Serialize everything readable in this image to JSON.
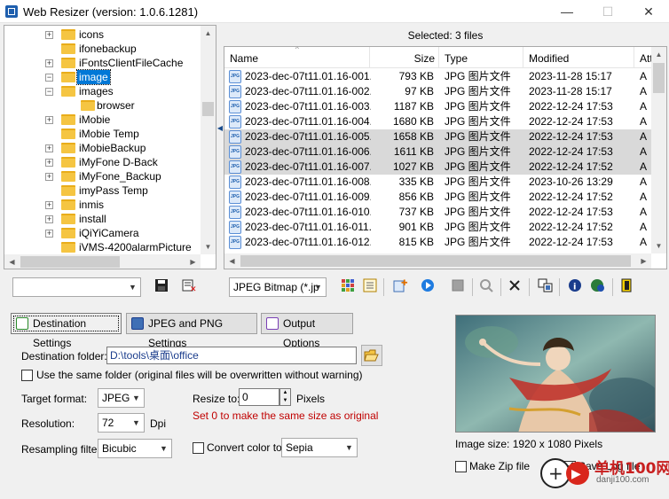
{
  "window": {
    "title": "Web Resizer (version: 1.0.6.1281)"
  },
  "tree": {
    "items": [
      {
        "label": "icons",
        "indent": 1,
        "expander": "+"
      },
      {
        "label": "ifonebackup",
        "indent": 1,
        "expander": ""
      },
      {
        "label": "iFontsClientFileCache",
        "indent": 1,
        "expander": "+"
      },
      {
        "label": "image",
        "indent": 1,
        "expander": "−",
        "selected": true
      },
      {
        "label": "images",
        "indent": 1,
        "expander": "−"
      },
      {
        "label": "browser",
        "indent": 2,
        "expander": ""
      },
      {
        "label": "iMobie",
        "indent": 1,
        "expander": "+"
      },
      {
        "label": "iMobie Temp",
        "indent": 1,
        "expander": ""
      },
      {
        "label": "iMobieBackup",
        "indent": 1,
        "expander": "+"
      },
      {
        "label": "iMyFone D-Back",
        "indent": 1,
        "expander": "+"
      },
      {
        "label": "iMyFone_Backup",
        "indent": 1,
        "expander": "+"
      },
      {
        "label": "imyPass Temp",
        "indent": 1,
        "expander": ""
      },
      {
        "label": "inmis",
        "indent": 1,
        "expander": "+"
      },
      {
        "label": "install",
        "indent": 1,
        "expander": "+"
      },
      {
        "label": "iQiYiCamera",
        "indent": 1,
        "expander": "+"
      },
      {
        "label": "iVMS-4200alarmPicture",
        "indent": 1,
        "expander": ""
      }
    ]
  },
  "filelist": {
    "selected_text": "Selected: 3 files",
    "columns": [
      "Name",
      "Size",
      "Type",
      "Modified",
      "Att"
    ],
    "rows": [
      {
        "name": "2023-dec-07t11.01.16-001.j...",
        "size": "793 KB",
        "type": "JPG 图片文件",
        "modified": "2023-11-28 15:17",
        "attr": "A",
        "sel": false
      },
      {
        "name": "2023-dec-07t11.01.16-002.j...",
        "size": "97 KB",
        "type": "JPG 图片文件",
        "modified": "2023-11-28 15:17",
        "attr": "A",
        "sel": false
      },
      {
        "name": "2023-dec-07t11.01.16-003.j...",
        "size": "1187 KB",
        "type": "JPG 图片文件",
        "modified": "2022-12-24 17:53",
        "attr": "A",
        "sel": false
      },
      {
        "name": "2023-dec-07t11.01.16-004.j...",
        "size": "1680 KB",
        "type": "JPG 图片文件",
        "modified": "2022-12-24 17:53",
        "attr": "A",
        "sel": false
      },
      {
        "name": "2023-dec-07t11.01.16-005.j...",
        "size": "1658 KB",
        "type": "JPG 图片文件",
        "modified": "2022-12-24 17:53",
        "attr": "A",
        "sel": true
      },
      {
        "name": "2023-dec-07t11.01.16-006.j...",
        "size": "1611 KB",
        "type": "JPG 图片文件",
        "modified": "2022-12-24 17:53",
        "attr": "A",
        "sel": true
      },
      {
        "name": "2023-dec-07t11.01.16-007.j...",
        "size": "1027 KB",
        "type": "JPG 图片文件",
        "modified": "2022-12-24 17:52",
        "attr": "A",
        "sel": true
      },
      {
        "name": "2023-dec-07t11.01.16-008.j...",
        "size": "335 KB",
        "type": "JPG 图片文件",
        "modified": "2023-10-26 13:29",
        "attr": "A",
        "sel": false
      },
      {
        "name": "2023-dec-07t11.01.16-009.j...",
        "size": "856 KB",
        "type": "JPG 图片文件",
        "modified": "2022-12-24 17:52",
        "attr": "A",
        "sel": false
      },
      {
        "name": "2023-dec-07t11.01.16-010.j...",
        "size": "737 KB",
        "type": "JPG 图片文件",
        "modified": "2022-12-24 17:53",
        "attr": "A",
        "sel": false
      },
      {
        "name": "2023-dec-07t11.01.16-011.j...",
        "size": "901 KB",
        "type": "JPG 图片文件",
        "modified": "2022-12-24 17:52",
        "attr": "A",
        "sel": false
      },
      {
        "name": "2023-dec-07t11.01.16-012.j...",
        "size": "815 KB",
        "type": "JPG 图片文件",
        "modified": "2022-12-24 17:53",
        "attr": "A",
        "sel": false
      }
    ]
  },
  "toolbar": {
    "profile_value": "",
    "format_value": "JPEG Bitmap (*.jp"
  },
  "tabs": {
    "destination": "Destination Settings",
    "jpeg_png": "JPEG and PNG Settings",
    "output": "Output Options"
  },
  "settings": {
    "dest_folder_label": "Destination folder:",
    "dest_folder_value": "D:\\tools\\桌面\\office",
    "same_folder_label": "Use the same folder (original files will be overwritten without warning)",
    "target_format_label": "Target format:",
    "target_format_value": "JPEG",
    "resize_label": "Resize to:",
    "resize_value": "0",
    "pixels_label": "Pixels",
    "resize_hint": "Set 0 to make the same size as original",
    "resolution_label": "Resolution:",
    "resolution_value": "72",
    "dpi_label": "Dpi",
    "resampling_label": "Resampling filter:",
    "resampling_value": "Bicubic",
    "convert_label": "Convert color to:",
    "convert_value": "Sepia"
  },
  "preview": {
    "size_text": "Image size: 1920 x 1080 Pixels",
    "make_zip_label": "Make Zip file",
    "save_log_label": "Save Log file"
  },
  "watermark": {
    "text": "单机100网",
    "url": "danji100.com"
  },
  "colors": {
    "selection": "#0078d7",
    "hint": "#c00000",
    "folder": "#f5c542"
  }
}
